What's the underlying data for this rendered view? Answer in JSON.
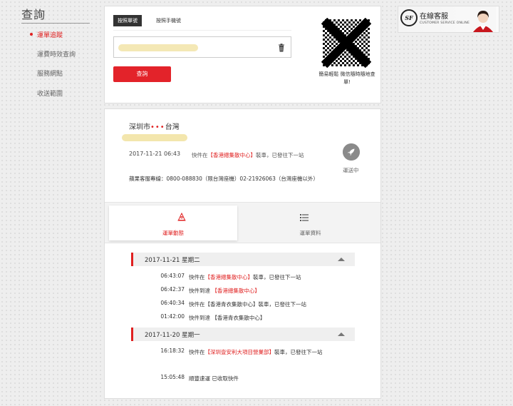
{
  "sidebar": {
    "title": "查詢",
    "items": [
      {
        "label": "運單追蹤",
        "active": true
      },
      {
        "label": "運費時效查詢",
        "active": false
      },
      {
        "label": "服務網點",
        "active": false
      },
      {
        "label": "收送範圍",
        "active": false
      }
    ]
  },
  "search": {
    "tab_waybill": "按照單號",
    "tab_phone": "按照手機號",
    "input_value": "",
    "query_button": "查詢",
    "qr_caption": "簡易輕鬆 微信隨時隨地查單!"
  },
  "customer_service": {
    "title": "在線客服",
    "subtitle": "CUSTOMER SERVICE ONLINE",
    "logo_text": "SF"
  },
  "shipment": {
    "origin": "深圳市",
    "route_dots": "•••",
    "destination": "台灣",
    "latest_time": "2017-11-21 06:43",
    "latest_prefix": "快件在",
    "latest_place": "【香港總集散中心】",
    "latest_suffix": "裝車，已發往下一站",
    "hotline": "蘋果客服專線：0800-088830（限台灣座機）02-21926063（台灣座機以外）",
    "status": "運送中"
  },
  "tabs": {
    "dynamics": "運單動態",
    "info": "運單資料"
  },
  "days": [
    {
      "date": "2017-11-21 星期二",
      "events": [
        {
          "time": "06:43:07",
          "pre": "快件在",
          "place": "【香港總集散中心】",
          "post": "裝車，已發往下一站",
          "red": true
        },
        {
          "time": "06:42:37",
          "pre": "快件到達 ",
          "place": "【香港總集散中心】",
          "post": "",
          "red": true
        },
        {
          "time": "06:40:34",
          "pre": "快件在",
          "place": "【香港青衣集散中心】",
          "post": "裝車，已發往下一站",
          "red": false
        },
        {
          "time": "01:42:00",
          "pre": "快件到達 ",
          "place": "【香港青衣集散中心】",
          "post": "",
          "red": false
        }
      ]
    },
    {
      "date": "2017-11-20 星期一",
      "events": [
        {
          "time": "16:18:32",
          "pre": "快件在",
          "place": "【深圳壹安利大項目營業部】",
          "post": "裝車，已發往下一站",
          "red": true
        },
        {
          "time": "15:05:48",
          "pre": "順豐速運 已收取快件",
          "place": "",
          "post": "",
          "red": false
        }
      ]
    }
  ],
  "colors": {
    "accent": "#e02020",
    "status_icon": "#888888"
  }
}
